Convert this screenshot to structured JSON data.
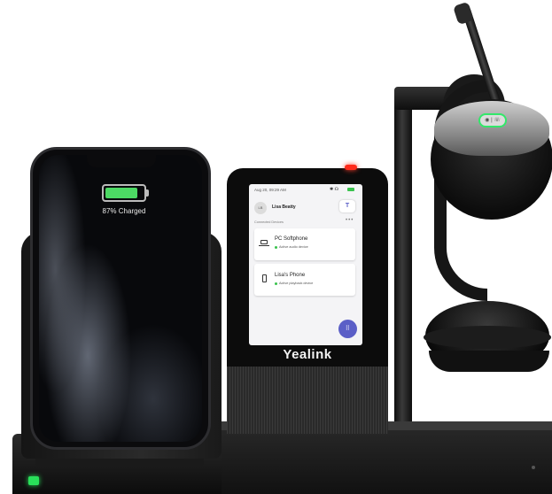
{
  "phone": {
    "charge_status": "87% Charged"
  },
  "display_unit": {
    "brand": "Yealink",
    "status_time": "Aug 20, 09:29 AM",
    "user": {
      "initials": "LB",
      "name": "Lisa Beatty"
    },
    "section_label": "Connected Devices",
    "more_symbol": "•••",
    "devices": [
      {
        "name": "PC Softphone",
        "status": "Active audio device",
        "icon": "laptop-icon"
      },
      {
        "name": "Lisa's Phone",
        "status": "Active playback device",
        "icon": "mobile-icon"
      }
    ],
    "dialpad_symbol": "⠿",
    "teams_symbol": "T"
  },
  "headset": {
    "button_symbol": "◉ | ☏"
  },
  "colors": {
    "charger_led": "#29e05a",
    "unit_led": "#ff2a1a",
    "teams_purple": "#5b5fc7",
    "active_green": "#3ac34e"
  }
}
